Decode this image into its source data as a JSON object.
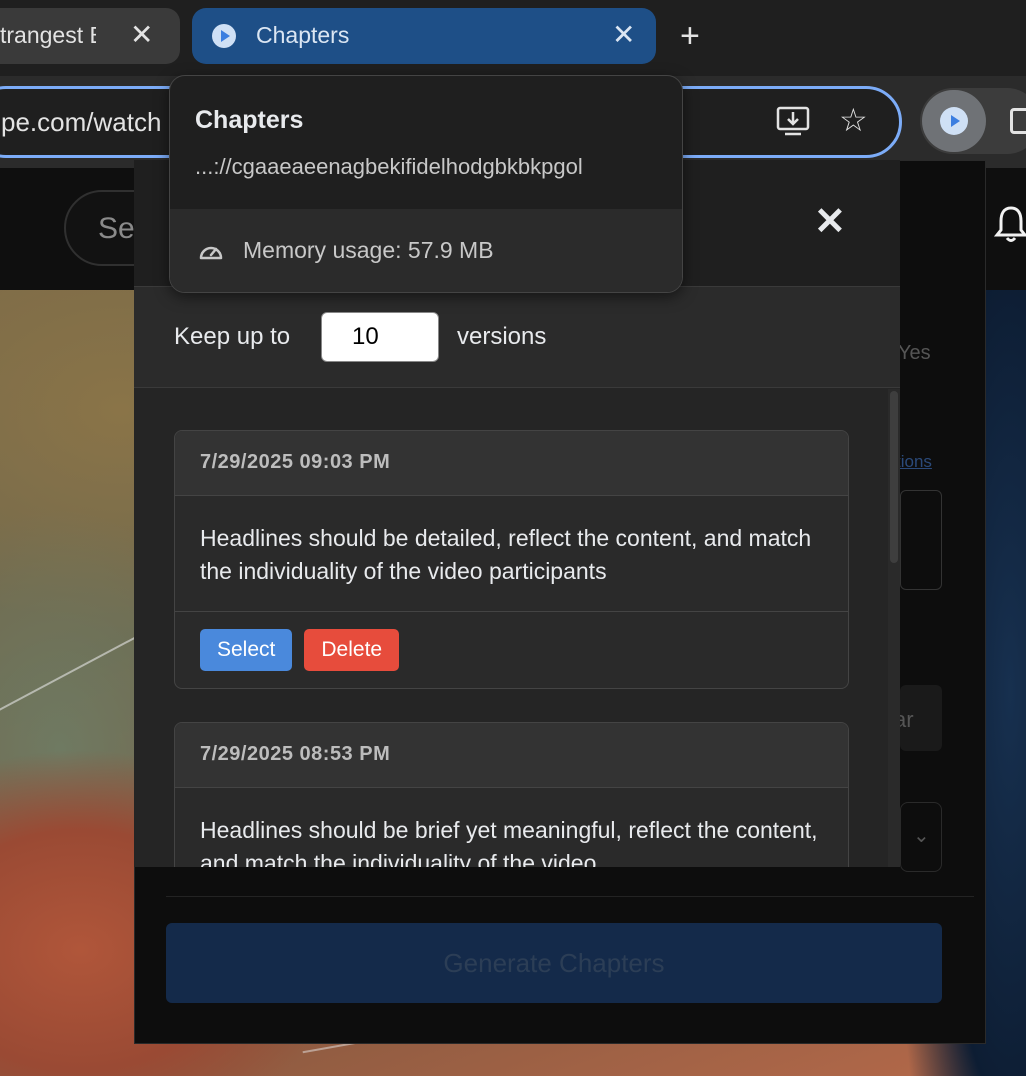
{
  "browser": {
    "tabs": [
      {
        "label": "trangest B",
        "active": false
      },
      {
        "label": "Chapters",
        "active": true
      }
    ],
    "new_tab": "+",
    "address_text": "pe.com/watch"
  },
  "extension_tooltip": {
    "name": "Chapters",
    "id_text": "...://cgaaeaeenagbekifidelhodgbkbkpgol",
    "memory_text": "Memory usage: 57.9 MB"
  },
  "page_background": {
    "search_placeholder": "Se",
    "yes_label": "Yes",
    "link_text": "tions",
    "button_partial": "ar",
    "generate_label": "Generate Chapters"
  },
  "versions_modal": {
    "close_symbol": "✕",
    "keep_label": "Keep up to",
    "keep_value": "10",
    "keep_suffix": "versions",
    "items": [
      {
        "date": "7/29/2025 09:03 PM",
        "text": "Headlines should be detailed, reflect the content, and match the individuality of the video participants",
        "select_label": "Select",
        "delete_label": "Delete"
      },
      {
        "date": "7/29/2025 08:53 PM",
        "text": "Headlines should be brief yet meaningful, reflect the content, and match the individuality of the video"
      }
    ]
  },
  "colors": {
    "accent_blue": "#4a89dc",
    "delete_red": "#e74c3c",
    "active_tab": "#1e4f87",
    "focus_ring": "#7cacf8"
  }
}
